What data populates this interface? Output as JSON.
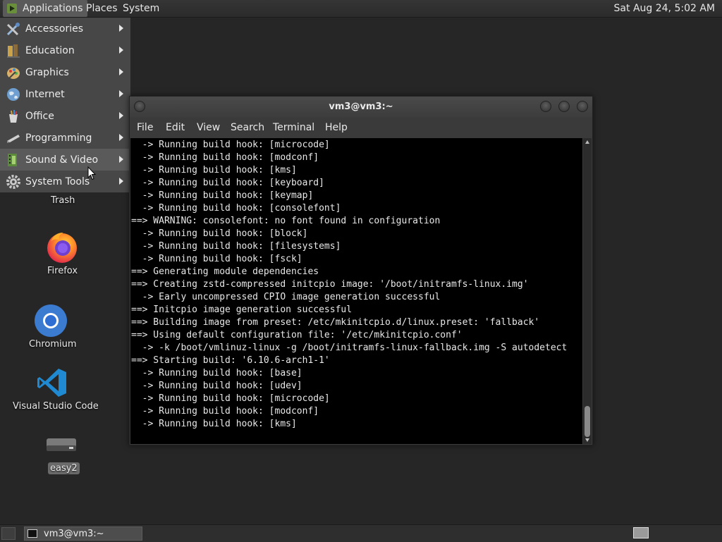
{
  "top_panel": {
    "applications": "Applications",
    "places": "Places",
    "system": "System",
    "clock": "Sat Aug 24,  5:02 AM"
  },
  "apps_menu": {
    "items": [
      {
        "label": "Accessories",
        "icon": "accessories-icon"
      },
      {
        "label": "Education",
        "icon": "education-icon"
      },
      {
        "label": "Graphics",
        "icon": "graphics-icon"
      },
      {
        "label": "Internet",
        "icon": "internet-icon"
      },
      {
        "label": "Office",
        "icon": "office-icon"
      },
      {
        "label": "Programming",
        "icon": "programming-icon"
      },
      {
        "label": "Sound & Video",
        "icon": "sound-video-icon"
      },
      {
        "label": "System Tools",
        "icon": "system-tools-icon"
      }
    ],
    "hovered": "Sound & Video"
  },
  "desktop": {
    "trash": "Trash",
    "firefox": "Firefox",
    "chromium": "Chromium",
    "vscode": "Visual Studio Code",
    "drive": "easy2"
  },
  "terminal": {
    "title": "vm3@vm3:~",
    "menu": [
      "File",
      "Edit",
      "View",
      "Search",
      "Terminal",
      "Help"
    ],
    "lines": [
      "  -> Running build hook: [microcode]",
      "  -> Running build hook: [modconf]",
      "  -> Running build hook: [kms]",
      "  -> Running build hook: [keyboard]",
      "  -> Running build hook: [keymap]",
      "  -> Running build hook: [consolefont]",
      "==> WARNING: consolefont: no font found in configuration",
      "  -> Running build hook: [block]",
      "  -> Running build hook: [filesystems]",
      "  -> Running build hook: [fsck]",
      "==> Generating module dependencies",
      "==> Creating zstd-compressed initcpio image: '/boot/initramfs-linux.img'",
      "  -> Early uncompressed CPIO image generation successful",
      "==> Initcpio image generation successful",
      "==> Building image from preset: /etc/mkinitcpio.d/linux.preset: 'fallback'",
      "==> Using default configuration file: '/etc/mkinitcpio.conf'",
      "  -> -k /boot/vmlinuz-linux -g /boot/initramfs-linux-fallback.img -S autodetect",
      "==> Starting build: '6.10.6-arch1-1'",
      "  -> Running build hook: [base]",
      "  -> Running build hook: [udev]",
      "  -> Running build hook: [microcode]",
      "  -> Running build hook: [modconf]",
      "  -> Running build hook: [kms]"
    ]
  },
  "taskbar": {
    "window": "vm3@vm3:~"
  }
}
